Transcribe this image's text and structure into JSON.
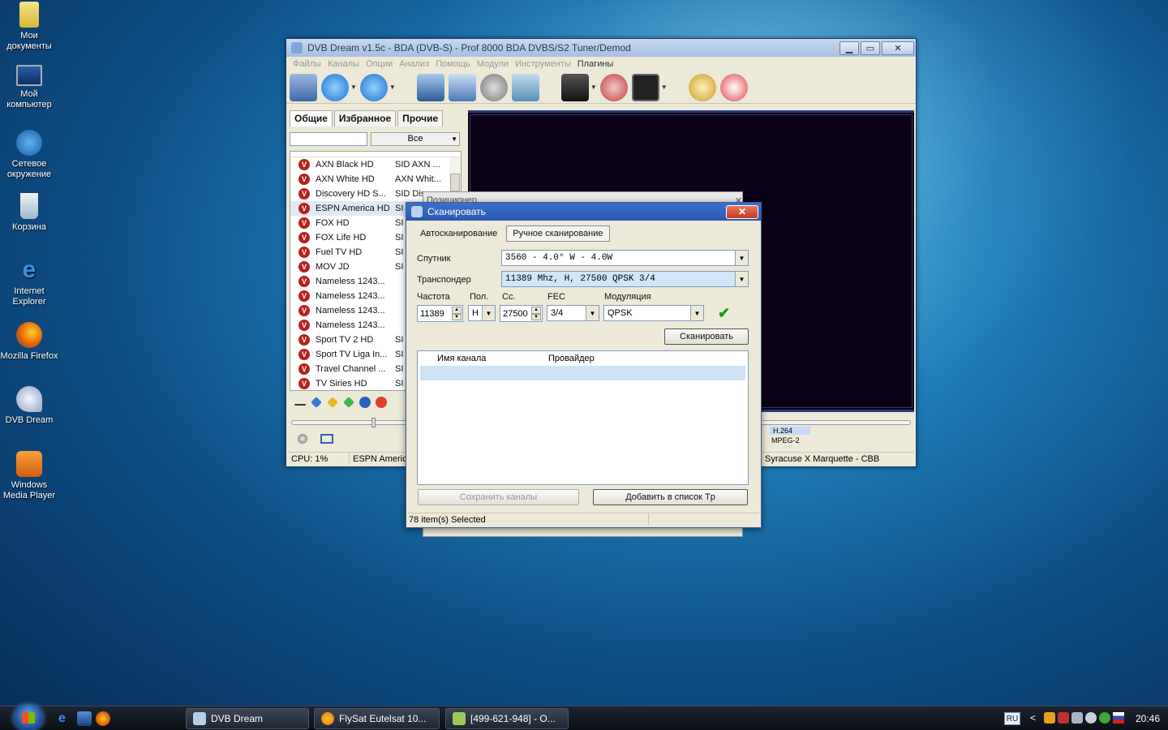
{
  "desktop": {
    "icons": [
      {
        "label": "Мои документы"
      },
      {
        "label": "Мой компьютер"
      },
      {
        "label": "Сетевое окружение"
      },
      {
        "label": "Корзина"
      },
      {
        "label": "Internet Explorer"
      },
      {
        "label": "Mozilla Firefox"
      },
      {
        "label": "DVB Dream"
      },
      {
        "label": "Windows Media Player"
      }
    ]
  },
  "main": {
    "title": "DVB Dream v1.5c - BDA (DVB-S) - Prof 8000 BDA DVBS/S2 Tuner/Demod",
    "menu": [
      "Файлы",
      "Каналы",
      "Опции",
      "Анализ",
      "Помощь",
      "Модули",
      "Инструменты",
      "Плагины"
    ],
    "tabs": [
      "Общие",
      "Избранное",
      "Прочие"
    ],
    "filter_select": "Все",
    "channels": [
      {
        "name": "AXN Black HD",
        "sid": "SID AXN ..."
      },
      {
        "name": "AXN White HD",
        "sid": "AXN Whit..."
      },
      {
        "name": "Discovery HD S...",
        "sid": "SID Disco..."
      },
      {
        "name": "ESPN America HD",
        "sid": "SI"
      },
      {
        "name": "FOX HD",
        "sid": "SI"
      },
      {
        "name": "FOX Life HD",
        "sid": "SI"
      },
      {
        "name": "Fuel TV HD",
        "sid": "SI"
      },
      {
        "name": "MOV JD",
        "sid": "SI"
      },
      {
        "name": "Nameless 1243...",
        "sid": ""
      },
      {
        "name": "Nameless 1243...",
        "sid": ""
      },
      {
        "name": "Nameless 1243...",
        "sid": ""
      },
      {
        "name": "Nameless 1243...",
        "sid": ""
      },
      {
        "name": "Sport TV 2 HD",
        "sid": "SI"
      },
      {
        "name": "Sport TV Liga In...",
        "sid": "SI"
      },
      {
        "name": "Travel Channel ...",
        "sid": "SI"
      },
      {
        "name": "TV Siries HD",
        "sid": "SI"
      }
    ],
    "selected_channel_index": 3,
    "codec1": "H.264",
    "codec2": "MPEG-2",
    "status_cpu": "CPU: 1%",
    "status_channel": "ESPN America",
    "status_program": "Syracuse X Marquette - CBB"
  },
  "ghost_dialog": {
    "title": "Позиционер"
  },
  "scan_dialog": {
    "title": "Сканировать",
    "tabs": [
      "Автосканирование",
      "Ручное сканирование"
    ],
    "satellite_label": "Спутник",
    "satellite_value": "3560 -  4.0° W - 4.0W",
    "transponder_label": "Транспондер",
    "transponder_value": "11389 Mhz, H, 27500   QPSK 3/4",
    "freq_label": "Частота",
    "freq_value": "11389",
    "pol_label": "Пол.",
    "pol_value": "H",
    "sr_label": "Сс.",
    "sr_value": "27500",
    "fec_label": "FEC",
    "fec_value": "3/4",
    "mod_label": "Модуляция",
    "mod_value": "QPSK",
    "scan_button": "Сканировать",
    "col_channel": "Имя канала",
    "col_provider": "Провайдер",
    "save_button": "Сохранить каналы",
    "add_button": "Добавить в список Tp",
    "status": "78 item(s) Selected"
  },
  "taskbar": {
    "buttons": [
      "DVB Dream",
      "FlySat Eutelsat 10...",
      "[499-621-948] - O..."
    ],
    "lang": "RU",
    "clock": "20:46"
  }
}
